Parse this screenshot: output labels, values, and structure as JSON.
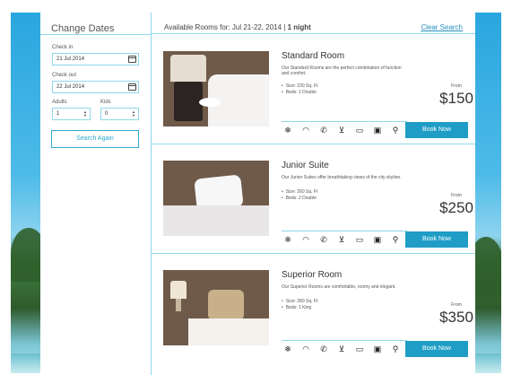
{
  "sidebar": {
    "title": "Change Dates",
    "checkin_label": "Check in",
    "checkin_value": "21 Jul 2014",
    "checkout_label": "Check out",
    "checkout_value": "22 Jul 2014",
    "adults_label": "Adults",
    "adults_value": "1",
    "kids_label": "Kids",
    "kids_value": "0",
    "search_button": "Search Again"
  },
  "header": {
    "available_prefix": "Available Rooms for: Jul 21-22, 2014 | ",
    "nights": "1 night",
    "clear_search": "Clear Search"
  },
  "rooms": [
    {
      "name": "Standard Room",
      "description": "Our Standard Rooms are the perfect combination of function and comfort.",
      "size": "Size: 230 Sq. Ft",
      "beds": "Beds: 1 Double",
      "from_label": "From",
      "price": "$150",
      "book_label": "Book Now"
    },
    {
      "name": "Junior Suite",
      "description": "Our Junior Suites offer breathtaking views of the city skyline.",
      "size": "Size: 260 Sq. Ft",
      "beds": "Beds: 2 Double",
      "from_label": "From",
      "price": "$250",
      "book_label": "Book Now"
    },
    {
      "name": "Superior Room",
      "description": "Our Superior Rooms are comfortable, roomy and elegant.",
      "size": "Size: 280 Sq. Ft",
      "beds": "Beds: 1 King",
      "from_label": "From",
      "price": "$350",
      "book_label": "Book Now"
    }
  ],
  "amenity_icons": [
    "snowflake-icon",
    "wifi-icon",
    "phone-icon",
    "drink-icon",
    "tv-icon",
    "safe-icon",
    "dining-icon"
  ],
  "colors": {
    "accent": "#1f9dc6",
    "border": "#8fd7ea",
    "link": "#2a8fbf"
  }
}
